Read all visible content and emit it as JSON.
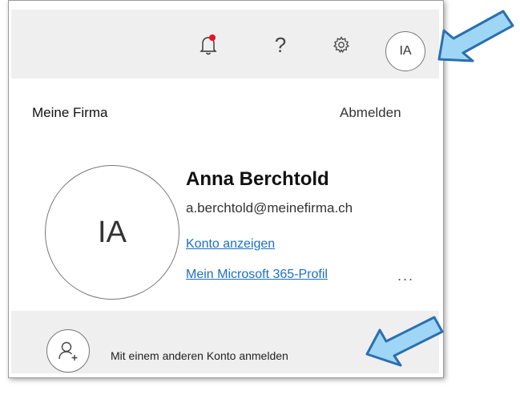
{
  "header": {
    "bell_icon": "notification-bell-icon",
    "help_label": "?",
    "gear_icon": "settings-gear-icon",
    "avatar_initials": "IA"
  },
  "account": {
    "company": "Meine Firma",
    "sign_out_label": "Abmelden",
    "avatar_initials": "IA",
    "name": "Anna Berchtold",
    "email": "a.berchtold@meinefirma.ch",
    "view_account_label": "Konto anzeigen",
    "profile_label": "Mein Microsoft 365-Profil",
    "more_label": "..."
  },
  "footer": {
    "add_account_label": "Mit einem anderen Konto anmelden",
    "add_account_icon": "add-person-icon"
  },
  "colors": {
    "link": "#1b6fc4",
    "arrow_fill": "#9fd6f5",
    "arrow_stroke": "#2a6fb0",
    "notification_dot": "#e81123"
  }
}
